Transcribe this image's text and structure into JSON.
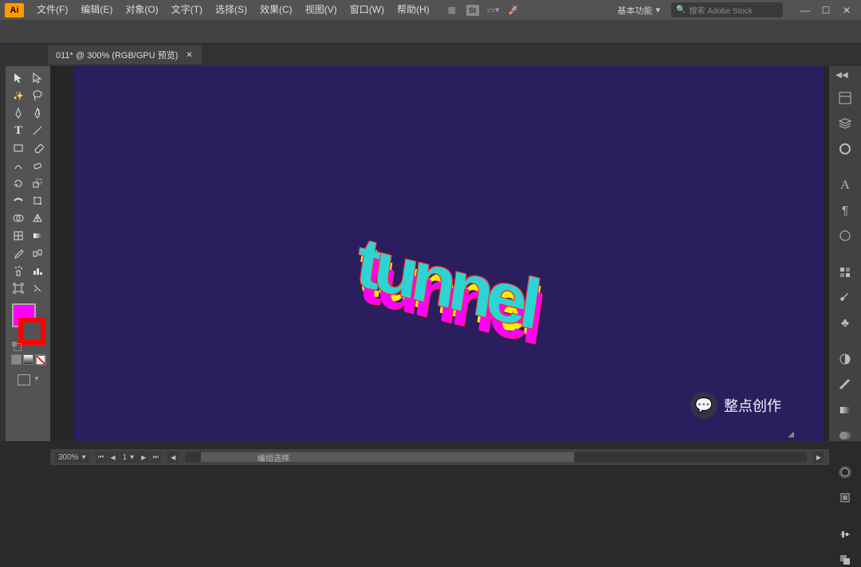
{
  "app_logo": "Ai",
  "menu": {
    "file": "文件(F)",
    "edit": "编辑(E)",
    "object": "对象(O)",
    "text": "文字(T)",
    "select": "选择(S)",
    "effect": "效果(C)",
    "view": "视图(V)",
    "window": "窗口(W)",
    "help": "帮助(H)"
  },
  "workspace": "基本功能",
  "search_placeholder": "搜索 Adobe Stock",
  "document_tab": "011* @ 300% (RGB/GPU 预览)",
  "canvas_text": "tunnel",
  "statusbar": {
    "zoom": "300%",
    "nav_value": "1",
    "group_selection": "编组选择"
  },
  "watermark": "整点创作",
  "colors": {
    "fill": "#ff00ff",
    "stroke": "#ff0000",
    "artboard_bg": "#2a1e5e",
    "text_face": "#2dd4d4",
    "text_side_magenta": "#ff00ff",
    "text_side_yellow": "#ffee00",
    "text_outline": "#ff2a2a"
  },
  "tools": {
    "selection": "selection-tool",
    "direct_selection": "direct-selection-tool",
    "magic_wand": "magic-wand-tool",
    "lasso": "lasso-tool",
    "pen": "pen-tool",
    "curvature": "curvature-tool",
    "type": "type-tool",
    "line": "line-tool",
    "rectangle": "rectangle-tool",
    "paintbrush": "paintbrush-tool",
    "shaper": "shaper-tool",
    "eraser": "eraser-tool",
    "rotate": "rotate-tool",
    "scale": "scale-tool",
    "width": "width-tool",
    "free_transform": "free-transform-tool",
    "shape_builder": "shape-builder-tool",
    "perspective": "perspective-tool",
    "mesh": "mesh-tool",
    "gradient": "gradient-tool",
    "eyedropper": "eyedropper-tool",
    "blend": "blend-tool",
    "symbol_sprayer": "symbol-sprayer-tool",
    "graph": "column-graph-tool",
    "artboard": "artboard-tool",
    "slice": "slice-tool"
  },
  "panels": {
    "properties": "properties-panel",
    "layers": "layers-panel",
    "cc_libraries": "cc-libraries-panel",
    "type_char": "character-panel",
    "paragraph": "paragraph-panel",
    "shape": "shape-panel",
    "swatches": "swatches-panel",
    "brushes": "brushes-panel",
    "symbols": "symbols-panel",
    "color": "color-panel",
    "stroke": "stroke-panel",
    "gradient": "gradient-panel",
    "transparency": "transparency-panel",
    "appearance": "appearance-panel",
    "graphic_styles": "graphic-styles-panel",
    "align": "align-panel",
    "pathfinder": "pathfinder-panel"
  }
}
